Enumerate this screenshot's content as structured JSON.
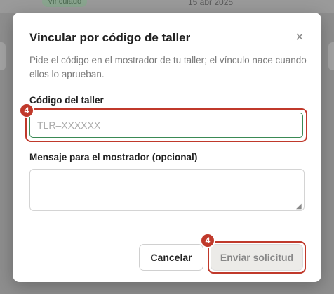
{
  "background": {
    "badge": "Vinculado",
    "date": "15 abr 2025"
  },
  "dialog": {
    "title": "Vincular por código de taller",
    "close_icon": "close-icon",
    "description": "Pide el código en el mostrador de tu taller; el vínculo nace cuando ellos lo aprueban.",
    "code_field": {
      "label": "Código del taller",
      "value": "",
      "placeholder": "TLR–XXXXXX"
    },
    "message_field": {
      "label": "Mensaje para el mostrador (opcional)",
      "value": "",
      "placeholder": ""
    },
    "buttons": {
      "cancel": "Cancelar",
      "send": "Enviar solicitud"
    },
    "step_badges": [
      "4",
      "4"
    ]
  },
  "colors": {
    "accent_red": "#c0392b",
    "focus_green": "#3a8a55"
  }
}
